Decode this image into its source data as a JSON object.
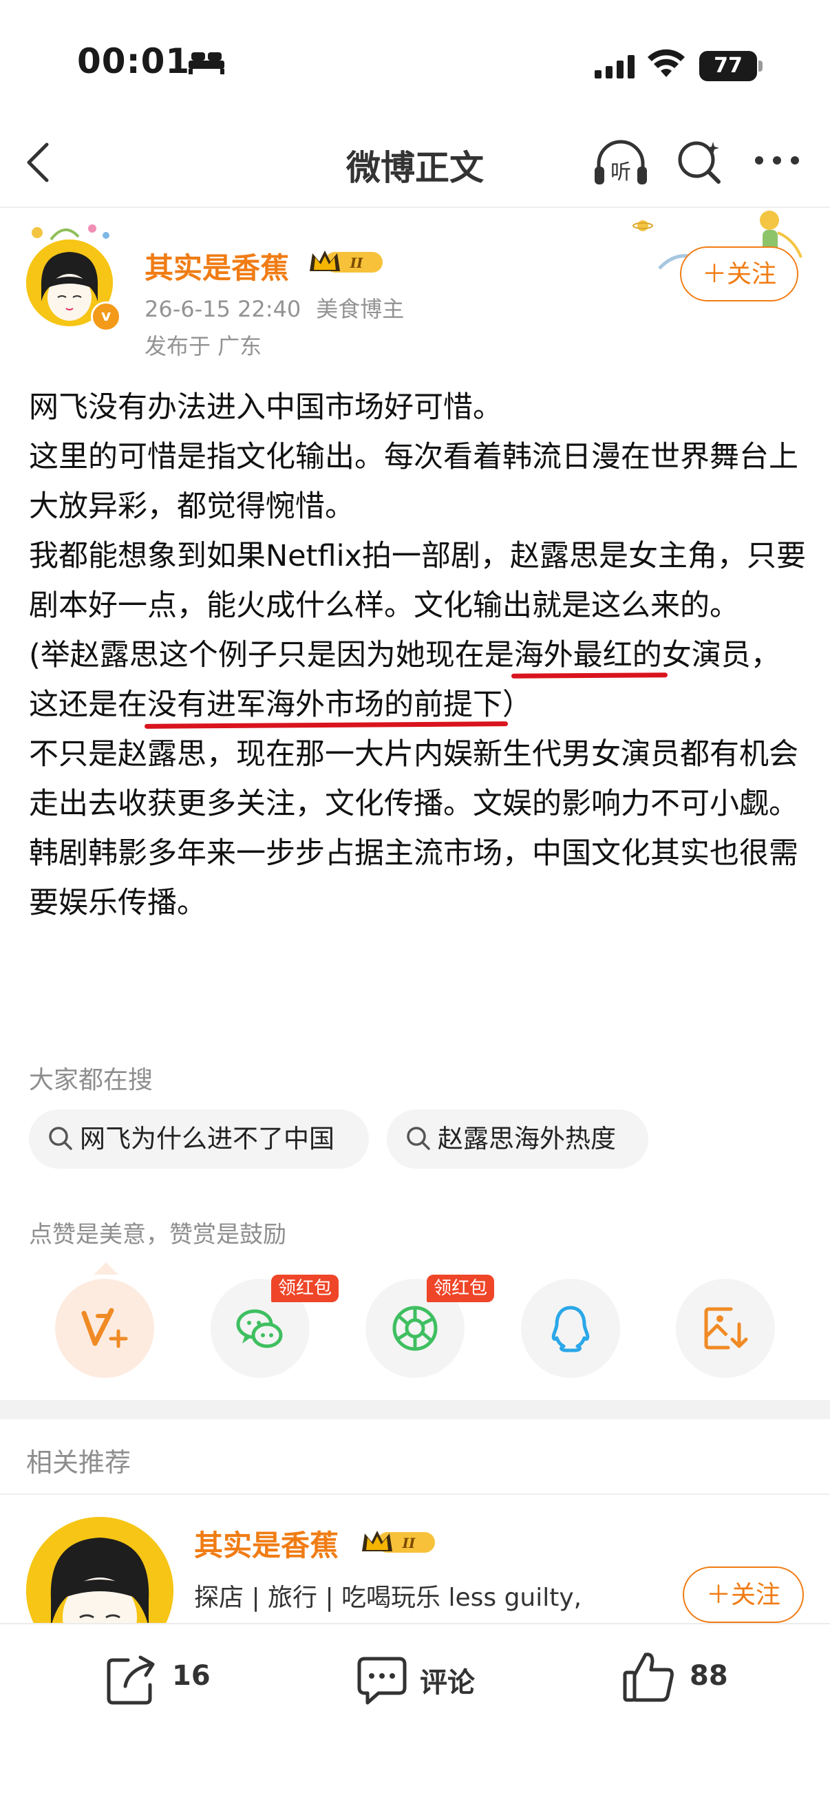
{
  "status_bar": {
    "time": "00:01",
    "battery": "77"
  },
  "nav": {
    "title": "微博正文"
  },
  "author": {
    "name": "其实是香蕉",
    "date": "26-6-15 22:40",
    "role": "美食博主",
    "location": "发布于 广东",
    "follow_label": "＋关注",
    "verified_mark": "v",
    "badge_level": "II"
  },
  "post": {
    "lines": [
      "网飞没有办法进入中国市场好可惜。",
      "这里的可惜是指文化输出。每次看着韩流日漫在世界舞台上大放异彩，都觉得惋惜。",
      "我都能想象到如果Netflix拍一部剧，赵露思是女主角，只要剧本好一点，能火成什么样。文化输出就是这么来的。"
    ],
    "paren_1": "(举赵露思这个例子只是因为她现在是",
    "paren_u1": "海外最红的",
    "paren_2": "女演员，这还是在",
    "paren_u2": "没有进军海外市场的前提下",
    "paren_3": "）",
    "lines_after": [
      "不只是赵露思，现在那一大片内娱新生代男女演员都有机会走出去收获更多关注，文化传播。文娱的影响力不可小觑。",
      "韩剧韩影多年来一步步占据主流市场，中国文化其实也很需要娱乐传播。"
    ]
  },
  "hot_search": {
    "label": "大家都在搜",
    "items": [
      "网飞为什么进不了中国",
      "赵露思海外热度"
    ]
  },
  "reward": {
    "label": "点赞是美意，赞赏是鼓励",
    "red_tag": "领红包",
    "icons": [
      "v-plus-icon",
      "wechat-icon",
      "moments-icon",
      "qq-icon",
      "save-image-icon"
    ],
    "colors": {
      "accent": "#f07c14",
      "wechat": "#3fbf60",
      "qq": "#2aa7e8",
      "red": "#ef4528"
    }
  },
  "related": {
    "title": "相关推荐",
    "name": "其实是香蕉",
    "desc": "探店 | 旅行 | 吃喝玩乐 less guilty,",
    "follow_label": "＋关注",
    "badge_level": "II"
  },
  "bottom_bar": {
    "share_count": "16",
    "comment_label": "评论",
    "like_count": "88"
  }
}
